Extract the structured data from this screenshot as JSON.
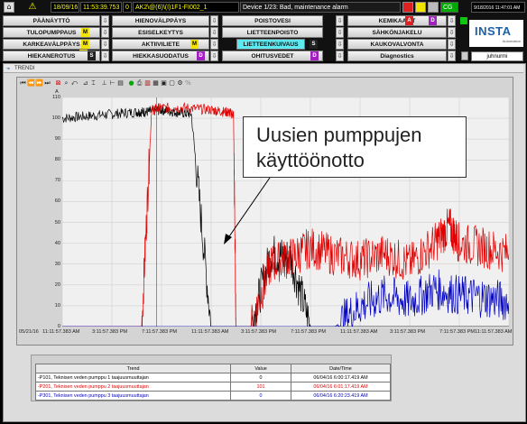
{
  "status_bar": {
    "date": "18/09/16",
    "time": "11:53:39.753",
    "count": "0",
    "tag": "AK2\\@(6)\\(I)1F1-FI002_1",
    "alarm": "Device 1/23: Bad, maintenance alarm",
    "cg_label": "CG",
    "clock": "9/18/2016 11:47:01 AM",
    "user": "juhnurmi"
  },
  "logo": {
    "text": "INSTA",
    "subtext": "Automation"
  },
  "nav": [
    {
      "label": "PÄÄNÄYTTÖ"
    },
    {
      "label": "TULOPUMPPAUS",
      "badge": "M",
      "badge_color": "#f2e400"
    },
    {
      "label": "KARKEAVÄLPPÄYS",
      "badge": "M",
      "badge_color": "#f2e400"
    },
    {
      "label": "HIEKANEROTUS",
      "badge": "S",
      "badge_color": "#222222"
    },
    {
      "label": "HIENOVÄLPPÄYS"
    },
    {
      "label": "ESISELKEYTYS"
    },
    {
      "label": "AKTIIVILIETE",
      "badge": "M",
      "badge_color": "#f2e400"
    },
    {
      "label": "HIEKKASUODATUS",
      "badge": "D",
      "badge_color": "#a020c0"
    },
    {
      "label": "POISTOVESI"
    },
    {
      "label": "LIETTEENPOISTO"
    },
    {
      "label": "LIETTEENKUIVAUS",
      "badge": "S",
      "badge_color": "#222222"
    },
    {
      "label": "OHITUSVEDET",
      "badge": "D",
      "badge_color": "#a020c0"
    },
    {
      "label": "KEMIKAALIT",
      "badge": "A",
      "badge_color": "#e02020",
      "badge2": "D",
      "badge2_color": "#a020c0"
    },
    {
      "label": "SÄHKÖNJAKELU"
    },
    {
      "label": "KAUKOVALVONTA"
    },
    {
      "label": "Diagnostics"
    }
  ],
  "trend": {
    "window_title": "TRENDI",
    "y_unit": "A",
    "annotation": "Uusien pumppujen käyttöönotto",
    "start_date": "05/21/16",
    "x_ticks": [
      "11:11:57.383 AM",
      "3:11:57.383 PM",
      "7:11:57.383 PM",
      "11:11:57.383 AM",
      "3:11:57.383 PM",
      "7:11:57.383 PM",
      "11:11:57.383 AM",
      "3:11:57.383 PM",
      "7:11:57.383 PM",
      "11:11:57.383 AM"
    ],
    "y_ticks": [
      "110",
      "100",
      "90",
      "80",
      "70",
      "60",
      "50",
      "40",
      "30",
      "20",
      "10",
      "0"
    ]
  },
  "legend": {
    "headers": [
      "Trend",
      "Value",
      "Date/Time"
    ],
    "rows": [
      {
        "name": "-P101, Teknisen veden pumppu 1 taajuusmuuttajan",
        "value": "0",
        "datetime": "06/04/16 6:00:17.419 AM",
        "color": "#000000"
      },
      {
        "name": "-P201, Teknisen veden pumppu 2 taajuusmuuttajan",
        "value": "101",
        "datetime": "06/04/16 6:01:17.419 AM",
        "color": "#e00000"
      },
      {
        "name": "-P301, Teknisen veden pumppu 3 taajuusmuuttajan",
        "value": "0",
        "datetime": "06/04/16 6:20:23.419 AM",
        "color": "#0000c0"
      }
    ]
  },
  "chart_data": {
    "type": "line",
    "ylabel": "A",
    "ylim": [
      0,
      110
    ],
    "grid": true,
    "x_tick_labels": [
      "11:11:57.383 AM",
      "3:11:57.383 PM",
      "7:11:57.383 PM",
      "11:11:57.383 AM",
      "3:11:57.383 PM",
      "7:11:57.383 PM",
      "11:11:57.383 AM",
      "3:11:57.383 PM",
      "7:11:57.383 PM",
      "11:11:57.383 AM"
    ],
    "series": [
      {
        "name": "-P101, Teknisen veden pumppu 1 taajuusmuuttajan",
        "color": "#000000",
        "x": [
          0,
          0.5,
          1,
          1.5,
          1.7,
          2,
          2.3,
          2.6,
          3.0,
          3.4,
          3.5,
          3.8,
          4.2,
          4.6,
          5,
          5.5,
          6,
          6.5,
          7,
          7.5,
          8,
          8.5,
          9
        ],
        "y": [
          100,
          101,
          102,
          103,
          103,
          104,
          103,
          102,
          0,
          0,
          0,
          0,
          35,
          33,
          0,
          0,
          0,
          0,
          0,
          0,
          0,
          0,
          0
        ]
      },
      {
        "name": "-P201, Teknisen veden pumppu 2 taajuusmuuttajan",
        "color": "#e00000",
        "x": [
          0,
          1.6,
          1.8,
          2,
          2.5,
          3,
          3.3,
          3.45,
          3.5,
          3.8,
          4.2,
          4.6,
          5,
          5.5,
          6,
          6.5,
          7,
          7.5,
          7.8,
          8,
          8.5,
          9
        ],
        "y": [
          0,
          0,
          104,
          105,
          105,
          104,
          103,
          102,
          0,
          0,
          30,
          33,
          38,
          34,
          32,
          35,
          30,
          40,
          48,
          40,
          38,
          35
        ]
      },
      {
        "name": "-P301, Teknisen veden pumppu 3 taajuusmuuttajan",
        "color": "#0000c0",
        "x": [
          0,
          5.5,
          6,
          6.5,
          7,
          7.5,
          8,
          8.5,
          9
        ],
        "y": [
          0,
          0,
          10,
          15,
          12,
          18,
          15,
          14,
          12
        ]
      }
    ]
  },
  "colors": {
    "accent": "#5ee8f0",
    "alarm_bg": "#1a1a1a",
    "status_text": "#ffff00"
  }
}
